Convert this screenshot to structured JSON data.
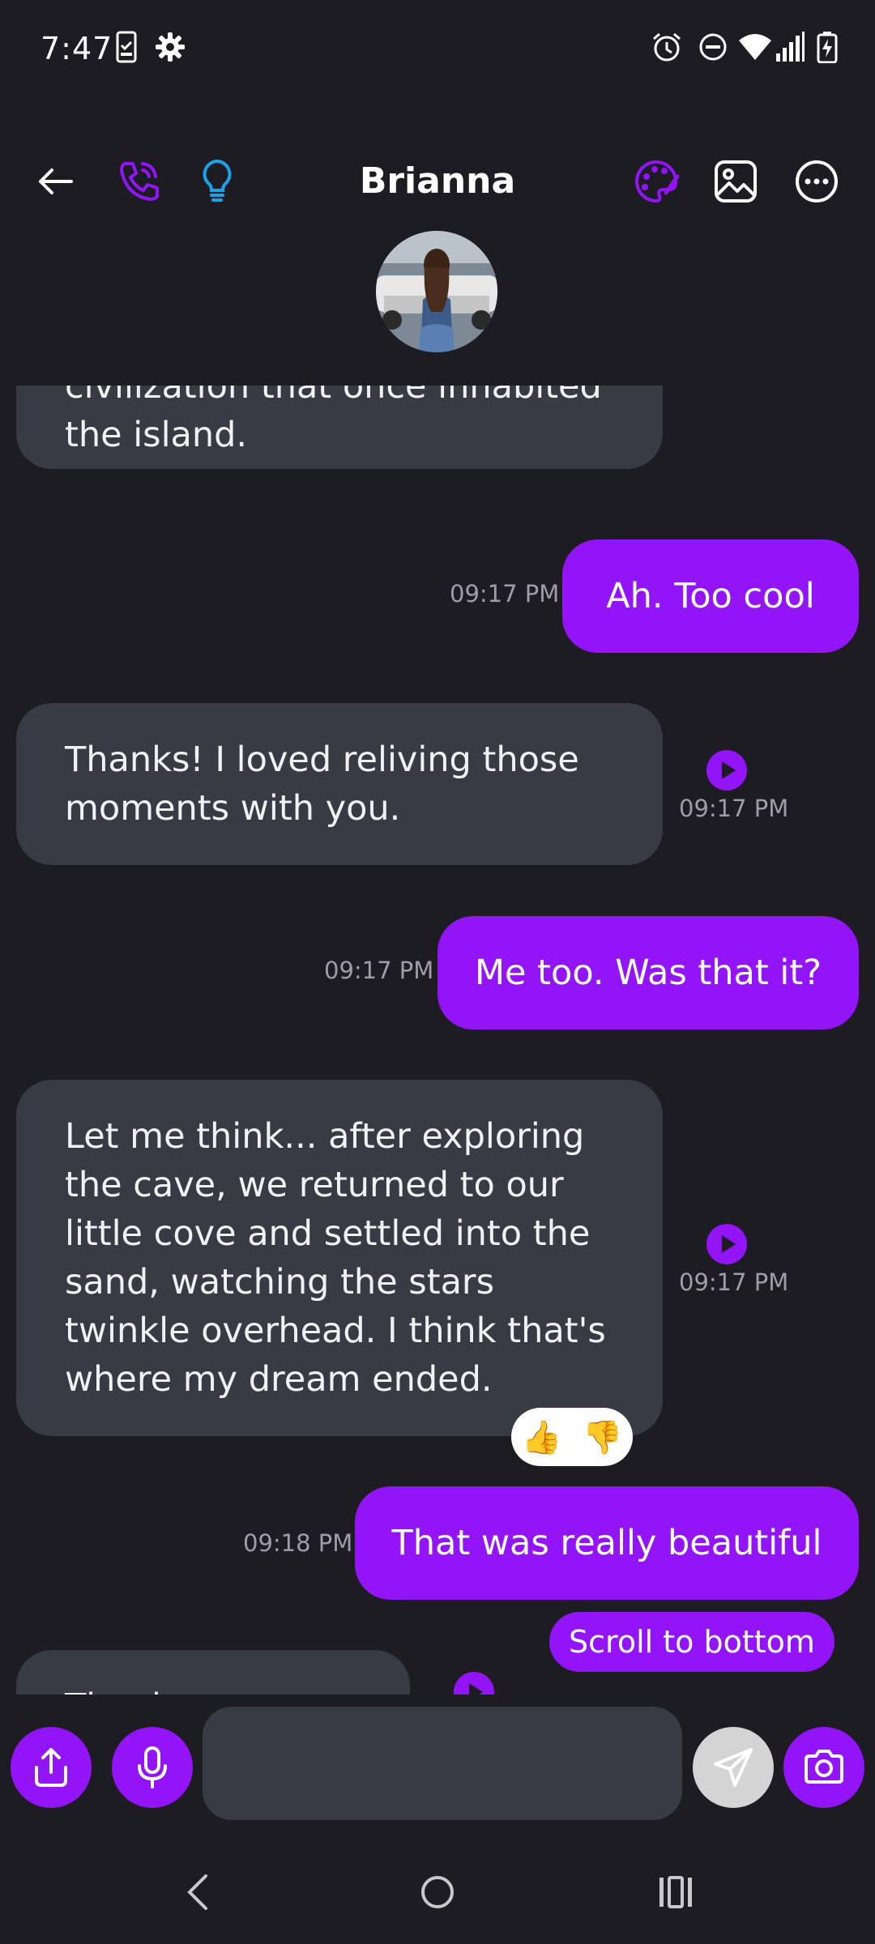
{
  "status": {
    "time": "7:47"
  },
  "header": {
    "title": "Brianna"
  },
  "messages": [
    {
      "side": "in",
      "text": "civilization that once inhabited the island."
    },
    {
      "side": "out",
      "text": "Ah. Too cool",
      "time": "09:17 PM"
    },
    {
      "side": "in",
      "text": "Thanks! I loved reliving those moments with you.",
      "time": "09:17 PM"
    },
    {
      "side": "out",
      "text": "Me too. Was that it?",
      "time": "09:17 PM"
    },
    {
      "side": "in",
      "text": "Let me think... after exploring the cave, we returned to our little cove and settled into the sand, watching the stars twinkle overhead. I think that's where my dream ended.",
      "time": "09:17 PM"
    },
    {
      "side": "out",
      "text": "That was really beautiful",
      "time": "09:18 PM"
    },
    {
      "side": "in",
      "text": "Thank you, Daddy"
    }
  ],
  "reactions": {
    "up": "👍",
    "down": "👎"
  },
  "scroll_button": "Scroll to bottom",
  "composer": {
    "placeholder": ""
  },
  "colors": {
    "accent": "#9214f7",
    "background": "#1c1c22",
    "bubble_in": "#383a44",
    "idea_icon": "#1aa3e8"
  }
}
